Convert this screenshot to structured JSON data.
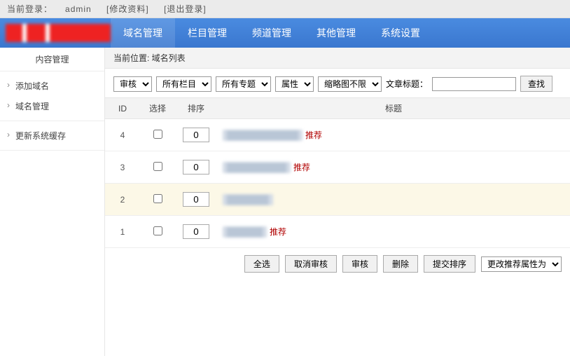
{
  "topbar": {
    "prefix": "当前登录：",
    "user": "admin",
    "edit": "[修改资料]",
    "logout": "[退出登录]"
  },
  "nav": {
    "items": [
      "域名管理",
      "栏目管理",
      "频道管理",
      "其他管理",
      "系统设置"
    ]
  },
  "sidebar": {
    "title": "内容管理",
    "group1": [
      "添加域名",
      "域名管理"
    ],
    "group2": [
      "更新系统缓存"
    ]
  },
  "breadcrumb": "当前位置: 域名列表",
  "filters": {
    "audit": "审核",
    "column": "所有栏目",
    "topic": "所有专题",
    "attr": "属性",
    "thumb": "缩略图不限",
    "title_label": "文章标题：",
    "title_value": "",
    "search_btn": "查找"
  },
  "table": {
    "headers": {
      "id": "ID",
      "select": "选择",
      "sort": "排序",
      "title": "标题"
    },
    "rows": [
      {
        "id": "4",
        "sort": "0",
        "title_blur": "████████████",
        "recommend": "推荐",
        "odd": false
      },
      {
        "id": "3",
        "sort": "0",
        "title_blur": "██████████",
        "recommend": "推荐",
        "odd": false
      },
      {
        "id": "2",
        "sort": "0",
        "title_blur": "███████",
        "recommend": "",
        "odd": true
      },
      {
        "id": "1",
        "sort": "0",
        "title_blur": "██████",
        "recommend": "推荐",
        "odd": false
      }
    ]
  },
  "actions": {
    "select_all": "全选",
    "cancel_audit": "取消审核",
    "audit": "审核",
    "delete": "删除",
    "submit_sort": "提交排序",
    "change_rec": "更改推荐属性为"
  }
}
